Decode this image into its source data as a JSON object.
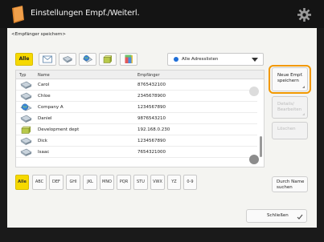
{
  "titlebar": {
    "title": "Einstellungen Empf./Weiterl."
  },
  "section": {
    "label": "<Empfänger speichern>"
  },
  "filter_tabs": [
    {
      "label": "Alle",
      "active": true
    },
    {
      "icon": "mail-icon"
    },
    {
      "icon": "fax-icon"
    },
    {
      "icon": "group-globe-icon"
    },
    {
      "icon": "file-server-icon"
    },
    {
      "icon": "group-color-icon"
    }
  ],
  "address_book": {
    "selected": "Alle Adresslisten"
  },
  "table": {
    "headers": {
      "type": "Typ",
      "name": "Name",
      "recipient": "Empfänger"
    },
    "rows": [
      {
        "icon": "fax-icon",
        "name": "Carol",
        "value": "8765432100"
      },
      {
        "icon": "fax-icon",
        "name": "Chloe",
        "value": "2345678900"
      },
      {
        "icon": "globe-icon",
        "name": "Company A",
        "value": "1234567890"
      },
      {
        "icon": "fax-icon",
        "name": "Daniel",
        "value": "9876543210"
      },
      {
        "icon": "file-server-icon",
        "name": "Development dept",
        "value": "192.168.0.230"
      },
      {
        "icon": "fax-icon",
        "name": "Dick",
        "value": "1234567890"
      },
      {
        "icon": "fax-icon",
        "name": "Isaac",
        "value": "7654321000"
      }
    ]
  },
  "side_buttons": {
    "new_save": {
      "line1": "Neue Empf.",
      "line2": "speichern"
    },
    "details_edit": {
      "line1": "Details/",
      "line2": "Bearbeiten"
    },
    "delete": {
      "label": "Löschen"
    }
  },
  "alpha_tabs": [
    "Alle",
    "ABC",
    "DEF",
    "GHI",
    "JKL",
    "MNO",
    "PQR",
    "STU",
    "VWX",
    "YZ",
    "0-9"
  ],
  "search_button": {
    "line1": "Durch Name",
    "line2": "suchen"
  },
  "close_button": {
    "label": "Schließen"
  },
  "colors": {
    "accent_yellow": "#f6d900",
    "highlight_orange": "#f29800",
    "title_bar": "#141414"
  }
}
